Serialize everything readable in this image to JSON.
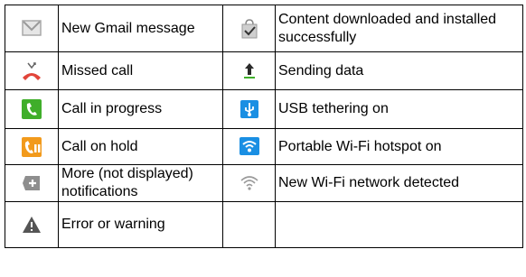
{
  "rows": [
    {
      "left": {
        "icon": "gmail-envelope-icon",
        "text": "New Gmail message"
      },
      "right": {
        "icon": "download-complete-bag-icon",
        "text": "Content downloaded and installed successfully"
      }
    },
    {
      "left": {
        "icon": "missed-call-icon",
        "text": "Missed call"
      },
      "right": {
        "icon": "upload-arrow-icon",
        "text": "Sending data"
      }
    },
    {
      "left": {
        "icon": "call-in-progress-icon",
        "text": "Call in progress"
      },
      "right": {
        "icon": "usb-icon",
        "text": "USB tethering on"
      }
    },
    {
      "left": {
        "icon": "call-on-hold-icon",
        "text": "Call on hold"
      },
      "right": {
        "icon": "wifi-hotspot-icon",
        "text": "Portable Wi-Fi hotspot on"
      }
    },
    {
      "left": {
        "icon": "more-notifications-plus-icon",
        "text": "More (not displayed) notifications"
      },
      "right": {
        "icon": "wifi-network-icon",
        "text": "New Wi-Fi network detected"
      }
    },
    {
      "left": {
        "icon": "warning-triangle-icon",
        "text": "Error or warning"
      },
      "right": {
        "icon": "",
        "text": ""
      }
    }
  ],
  "colors": {
    "green": "#3fae2a",
    "orange": "#f29a1c",
    "red": "#e2453a",
    "blue": "#1a8fe3",
    "gray": "#9a9a9a"
  }
}
